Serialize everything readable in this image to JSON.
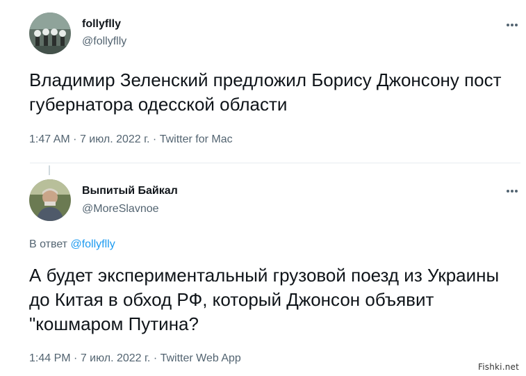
{
  "tweet1": {
    "name": "follyflly",
    "handle": "@follyflly",
    "text": "Владимир Зеленский предложил Борису Джонсону пост губернатора одесской области",
    "time": "1:47 AM",
    "date": "7 июл. 2022 г.",
    "source": "Twitter for Mac"
  },
  "tweet2": {
    "name": "Выпитый Байкал",
    "handle": "@MoreSlavnoe",
    "reply_prefix": "В ответ",
    "reply_mention": "@follyflly",
    "text": "А будет экспериментальный грузовой поезд из Украины до Китая в обход РФ, который Джонсон объявит \"кошмаром Путина?",
    "time": "1:44 PM",
    "date": "7 июл. 2022 г.",
    "source": "Twitter Web App"
  },
  "separator": "·",
  "watermark": "Fishki.net",
  "icons": [
    "more-icon"
  ],
  "colors": {
    "text": "#0f1419",
    "secondary": "#536471",
    "accent": "#1d9bf0"
  }
}
